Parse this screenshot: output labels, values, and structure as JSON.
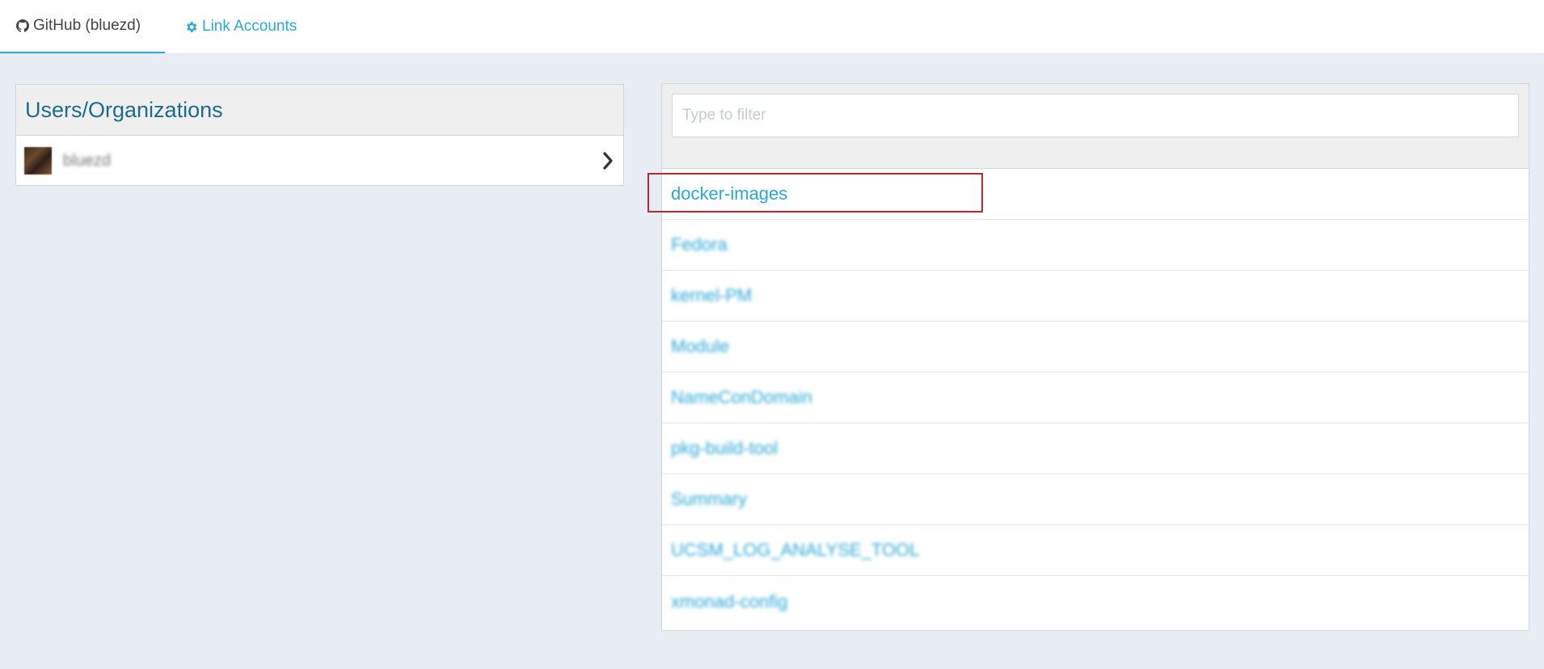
{
  "tabs": {
    "github_label": "GitHub (bluezd)",
    "link_accounts_label": "Link Accounts"
  },
  "users_panel": {
    "title": "Users/Organizations",
    "user": "bluezd"
  },
  "repos_panel": {
    "filter_placeholder": "Type to filter",
    "repos": [
      "docker-images",
      "Fedora",
      "kernel-PM",
      "Module",
      "NameConDomain",
      "pkg-build-tool",
      "Summary",
      "UCSM_LOG_ANALYSE_TOOL",
      "xmonad-config"
    ]
  },
  "colors": {
    "accent": "#2aa8d6",
    "title": "#1a6e8c",
    "highlight": "#c8232c",
    "background": "#e8edf4"
  }
}
